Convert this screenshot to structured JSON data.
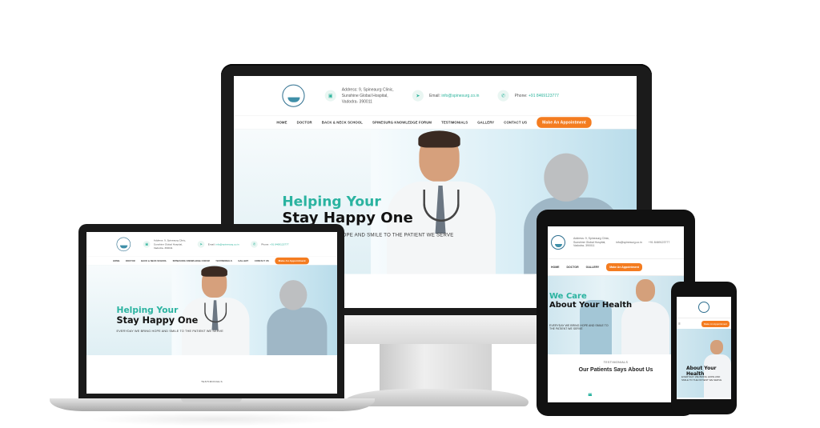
{
  "site": {
    "address_line1": "Address: 9, Spineaurg Clinic,",
    "address_line2": "Sunshine Global Hospital,",
    "address_line3": "Vadodra- 390011",
    "email_label": "Email:",
    "email": "info@spinesurg.co.in",
    "phone_label": "Phone:",
    "phone": "+91 8469123777",
    "nav": [
      "HOME",
      "DOCTOR",
      "BACK & NECK SCHOOL",
      "SPINESURG KNOWLEDGE FORUM",
      "TESTIMONIALS",
      "GALLERY",
      "CONTACT US"
    ],
    "appointment_label": "Make An Appointment",
    "hero_title1": "Helping Your",
    "hero_title2": "Stay Happy One",
    "hero_sub": "EVERYDAY WE BRING HOPE AND SMILE TO THE PATIENT WE SERVE",
    "testimonials_label": "TESTIMONIALS"
  },
  "tablet": {
    "hero_title1": "We Care",
    "hero_title2": "About Your Health",
    "section_label": "TESTIMONIALS",
    "section_title": "Our Patients Says About Us"
  },
  "phone": {
    "hero_title": "About Your Health",
    "appointment_label": "Make An Appointment"
  },
  "colors": {
    "accent": "#2ab3a0",
    "cta": "#f47c20",
    "device": "#1b1b1b"
  }
}
